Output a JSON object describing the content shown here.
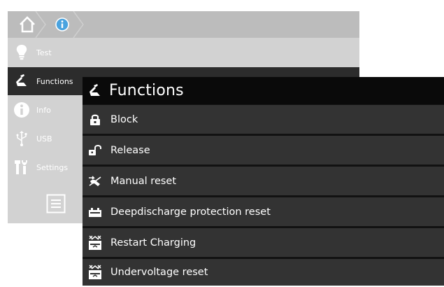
{
  "background": {
    "breadcrumb": {
      "home_icon": "home-icon",
      "info_icon": "info-icon"
    },
    "sidebar": {
      "items": [
        {
          "label": "Test",
          "icon": "bulb-icon"
        },
        {
          "label": "Functions",
          "icon": "wrench-icon",
          "active": true
        },
        {
          "label": "Info",
          "icon": "info-icon"
        },
        {
          "label": "USB",
          "icon": "usb-icon"
        },
        {
          "label": "Settings",
          "icon": "settings-icon"
        }
      ],
      "menu_icon": "menu-icon"
    }
  },
  "popup": {
    "title": "Functions",
    "title_icon": "wrench-icon",
    "items": [
      {
        "label": "Block",
        "icon": "lock-closed-icon"
      },
      {
        "label": "Release",
        "icon": "lock-open-icon"
      },
      {
        "label": "Manual reset",
        "icon": "manual-reset-icon"
      },
      {
        "label": "Deepdischarge protection reset",
        "icon": "battery-icon"
      },
      {
        "label": "Restart Charging",
        "icon": "charging-icon"
      },
      {
        "label": "Undervoltage reset",
        "icon": "charging-icon"
      }
    ]
  },
  "colors": {
    "panel_bg": "#d2d2d2",
    "breadcrumb_bg": "#bcbcbc",
    "active_bg": "#2c2c2c",
    "popup_row_bg": "#333333",
    "popup_header_bg": "#0a0a0a",
    "info_accent": "#4aa3df"
  }
}
